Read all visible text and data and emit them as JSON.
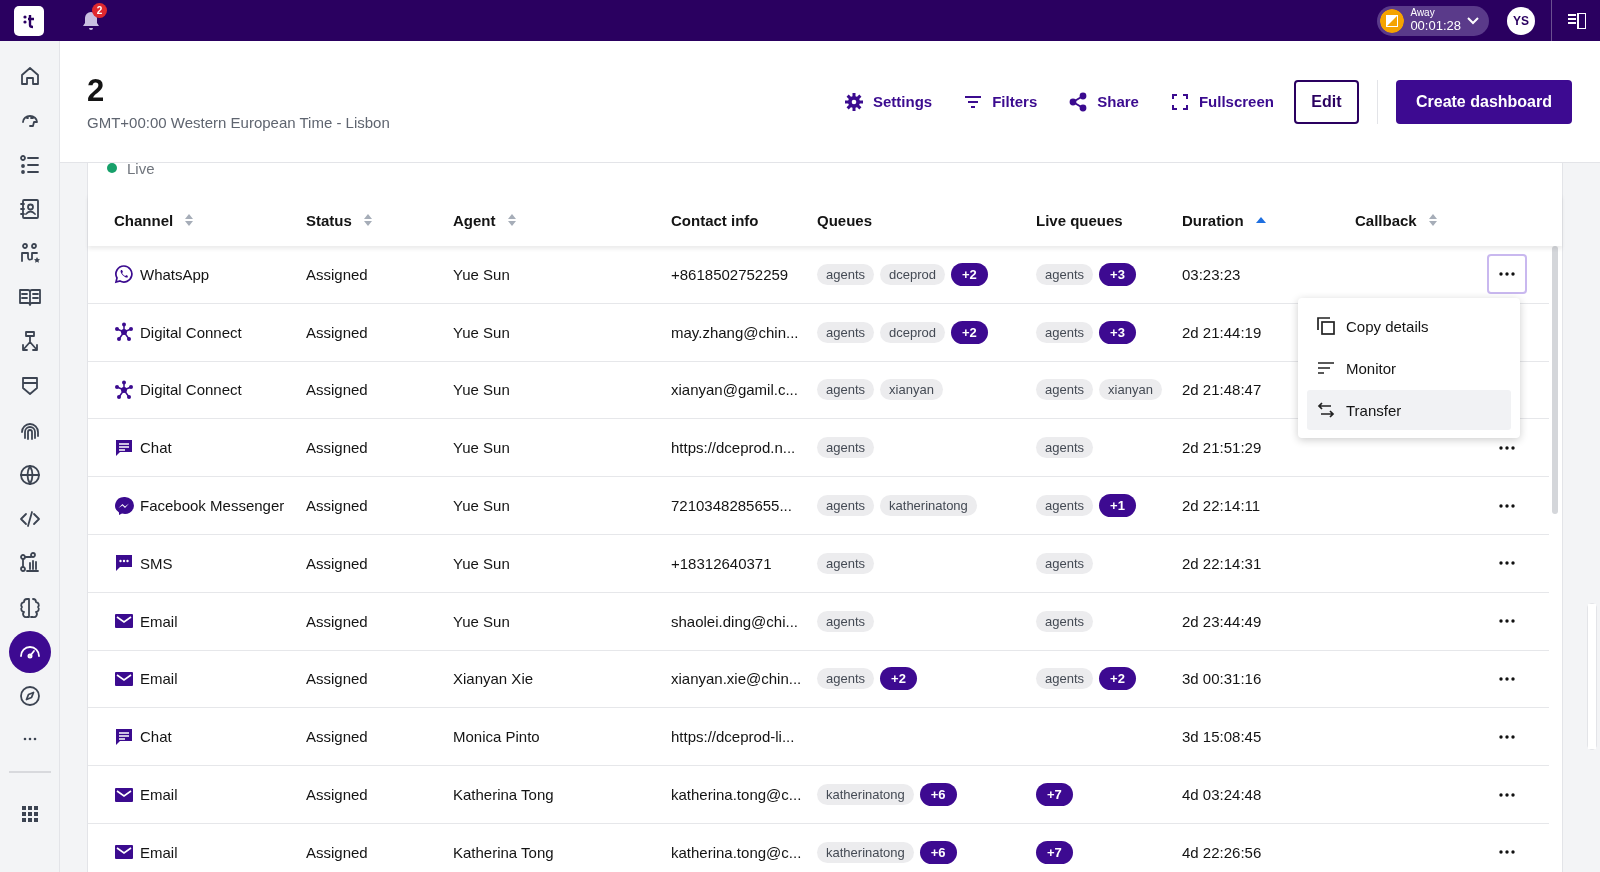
{
  "top_bar": {
    "notifications": "2",
    "status": {
      "label": "Away",
      "timer": "00:01:28"
    },
    "avatar": "YS"
  },
  "sidebar": {
    "items": [
      {
        "selected": false
      },
      {
        "selected": false
      },
      {
        "selected": false
      },
      {
        "selected": false
      },
      {
        "selected": false
      },
      {
        "selected": false
      },
      {
        "selected": false
      },
      {
        "selected": false
      },
      {
        "selected": false
      },
      {
        "selected": false
      },
      {
        "selected": false
      },
      {
        "selected": false
      },
      {
        "selected": false
      },
      {
        "selected": true
      },
      {
        "selected": false
      },
      {
        "selected": false
      }
    ]
  },
  "header": {
    "title": "2",
    "subtitle": "GMT+00:00 Western European Time - Lisbon",
    "actions": [
      {
        "kind": "settings",
        "label": "Settings"
      },
      {
        "kind": "filters",
        "label": "Filters"
      },
      {
        "kind": "share",
        "label": "Share"
      },
      {
        "kind": "fullscreen",
        "label": "Fullscreen"
      }
    ],
    "edit": "Edit",
    "create": "Create dashboard"
  },
  "live": "Live",
  "table": {
    "columns": [
      {
        "label": "Channel",
        "sortable": true,
        "sorted_ascending": false
      },
      {
        "label": "Status",
        "sortable": true,
        "sorted_ascending": false
      },
      {
        "label": "Agent",
        "sortable": true,
        "sorted_ascending": false
      },
      {
        "label": "Contact info",
        "sortable": false
      },
      {
        "label": "Queues",
        "sortable": false
      },
      {
        "label": "Live queues",
        "sortable": false
      },
      {
        "label": "Duration",
        "sortable": true,
        "sorted_ascending": true
      },
      {
        "label": "Callback",
        "sortable": true,
        "sorted_ascending": false
      }
    ],
    "rows": [
      {
        "channel": {
          "kind": "whatsapp",
          "label": "WhatsApp"
        },
        "status": "Assigned",
        "agent": "Yue Sun",
        "contact": "+8618502752259",
        "queues": [
          {
            "kind": "tag",
            "label": "agents"
          },
          {
            "kind": "tag",
            "label": "dceprod"
          },
          {
            "kind": "more",
            "label": "+2"
          }
        ],
        "live_queues": [
          {
            "kind": "tag",
            "label": "agents"
          },
          {
            "kind": "more",
            "label": "+3"
          }
        ],
        "duration": "03:23:23",
        "menu_open": true
      },
      {
        "channel": {
          "kind": "digital",
          "label": "Digital Connect"
        },
        "status": "Assigned",
        "agent": "Yue Sun",
        "contact": "may.zhang@chin...",
        "queues": [
          {
            "kind": "tag",
            "label": "agents"
          },
          {
            "kind": "tag",
            "label": "dceprod"
          },
          {
            "kind": "more",
            "label": "+2"
          }
        ],
        "live_queues": [
          {
            "kind": "tag",
            "label": "agents"
          },
          {
            "kind": "more",
            "label": "+3"
          }
        ],
        "duration": "2d 21:44:19"
      },
      {
        "channel": {
          "kind": "digital",
          "label": "Digital Connect"
        },
        "status": "Assigned",
        "agent": "Yue Sun",
        "contact": "xianyan@gamil.c...",
        "queues": [
          {
            "kind": "tag",
            "label": "agents"
          },
          {
            "kind": "tag",
            "label": "xianyan"
          }
        ],
        "live_queues": [
          {
            "kind": "tag",
            "label": "agents"
          },
          {
            "kind": "tag",
            "label": "xianyan"
          }
        ],
        "duration": "2d 21:48:47"
      },
      {
        "channel": {
          "kind": "chat",
          "label": "Chat"
        },
        "status": "Assigned",
        "agent": "Yue Sun",
        "contact": "https://dceprod.n...",
        "queues": [
          {
            "kind": "tag",
            "label": "agents"
          }
        ],
        "live_queues": [
          {
            "kind": "tag",
            "label": "agents"
          }
        ],
        "duration": "2d 21:51:29",
        "menu_open": false
      },
      {
        "channel": {
          "kind": "messenger",
          "label": "Facebook Messenger"
        },
        "status": "Assigned",
        "agent": "Yue Sun",
        "contact": "7210348285655...",
        "queues": [
          {
            "kind": "tag",
            "label": "agents"
          },
          {
            "kind": "tag",
            "label": "katherinatong"
          }
        ],
        "live_queues": [
          {
            "kind": "tag",
            "label": "agents"
          },
          {
            "kind": "more",
            "label": "+1"
          }
        ],
        "duration": "2d 22:14:11",
        "menu_open": false
      },
      {
        "channel": {
          "kind": "sms",
          "label": "SMS"
        },
        "status": "Assigned",
        "agent": "Yue Sun",
        "contact": "+18312640371",
        "queues": [
          {
            "kind": "tag",
            "label": "agents"
          }
        ],
        "live_queues": [
          {
            "kind": "tag",
            "label": "agents"
          }
        ],
        "duration": "2d 22:14:31",
        "menu_open": false
      },
      {
        "channel": {
          "kind": "email",
          "label": "Email"
        },
        "status": "Assigned",
        "agent": "Yue Sun",
        "contact": "shaolei.ding@chi...",
        "queues": [
          {
            "kind": "tag",
            "label": "agents"
          }
        ],
        "live_queues": [
          {
            "kind": "tag",
            "label": "agents"
          }
        ],
        "duration": "2d 23:44:49",
        "menu_open": false
      },
      {
        "channel": {
          "kind": "email",
          "label": "Email"
        },
        "status": "Assigned",
        "agent": "Xianyan Xie",
        "contact": "xianyan.xie@chin...",
        "queues": [
          {
            "kind": "tag",
            "label": "agents"
          },
          {
            "kind": "more",
            "label": "+2"
          }
        ],
        "live_queues": [
          {
            "kind": "tag",
            "label": "agents"
          },
          {
            "kind": "more",
            "label": "+2"
          }
        ],
        "duration": "3d 00:31:16",
        "menu_open": false
      },
      {
        "channel": {
          "kind": "chat",
          "label": "Chat"
        },
        "status": "Assigned",
        "agent": "Monica Pinto",
        "contact": "https://dceprod-li...",
        "queues": [],
        "live_queues": [],
        "duration": "3d 15:08:45",
        "menu_open": false
      },
      {
        "channel": {
          "kind": "email",
          "label": "Email"
        },
        "status": "Assigned",
        "agent": "Katherina Tong",
        "contact": "katherina.tong@c...",
        "queues": [
          {
            "kind": "tag",
            "label": "katherinatong"
          },
          {
            "kind": "more",
            "label": "+6"
          }
        ],
        "live_queues": [
          {
            "kind": "more",
            "label": "+7"
          }
        ],
        "duration": "4d 03:24:48",
        "menu_open": false
      },
      {
        "channel": {
          "kind": "email",
          "label": "Email"
        },
        "status": "Assigned",
        "agent": "Katherina Tong",
        "contact": "katherina.tong@c...",
        "queues": [
          {
            "kind": "tag",
            "label": "katherinatong"
          },
          {
            "kind": "more",
            "label": "+6"
          }
        ],
        "live_queues": [
          {
            "kind": "more",
            "label": "+7"
          }
        ],
        "duration": "4d 22:26:56",
        "menu_open": false
      }
    ]
  },
  "row_menu": {
    "items": [
      {
        "kind": "copy",
        "label": "Copy details",
        "highlighted": false
      },
      {
        "kind": "monitor",
        "label": "Monitor",
        "highlighted": false
      },
      {
        "kind": "transfer",
        "label": "Transfer",
        "highlighted": true
      }
    ]
  }
}
